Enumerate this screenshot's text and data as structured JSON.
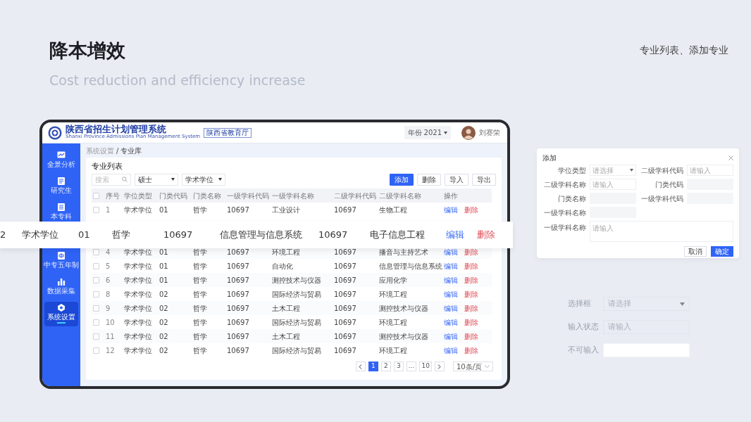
{
  "slide": {
    "title": "降本增效",
    "subtitle": "Cost reduction and efficiency increase",
    "caption": "专业列表、添加专业"
  },
  "header": {
    "system_name": "陕西省招生计划管理系统",
    "system_name_en": "Shanxi Province Admissions Plan Management System",
    "department_badge": "陕西省教育厅",
    "year_label": "年份",
    "year": "2021",
    "user_name": "刘赛荣"
  },
  "sidebar": {
    "groups": [
      [
        {
          "label": "全景分析",
          "selected": false
        },
        {
          "label": "研究生",
          "selected": false
        },
        {
          "label": "本专科",
          "selected": false
        }
      ],
      [
        {
          "label": "中专五年制",
          "selected": false
        },
        {
          "label": "数据采集",
          "selected": false
        },
        {
          "label": "系统设置",
          "selected": true
        }
      ]
    ]
  },
  "breadcrumb": {
    "items": [
      "系统设置",
      "专业库"
    ],
    "separator": "/"
  },
  "panel_title": "专业列表",
  "filters": {
    "search_placeholder": "搜索",
    "degree": "硕士",
    "degree_type": "学术学位"
  },
  "actions": [
    {
      "label": "添加",
      "primary": true
    },
    {
      "label": "删除",
      "primary": false
    },
    {
      "label": "导入",
      "primary": false
    },
    {
      "label": "导出",
      "primary": false
    }
  ],
  "table": {
    "header_checked": false,
    "columns": [
      "序号",
      "学位类型",
      "门类代码",
      "门类名称",
      "一级学科代码",
      "一级学科名称",
      "二级学科代码",
      "二级学科名称",
      "操作"
    ],
    "rows": [
      {
        "checked": false,
        "cells": [
          "1",
          "学术学位",
          "01",
          "哲学",
          "10697",
          "工业设计",
          "10697",
          "生物工程"
        ],
        "edit": "编辑",
        "delete": "删除"
      },
      {
        "checked": false,
        "cells": [
          "4",
          "学术学位",
          "01",
          "哲学",
          "10697",
          "环境工程",
          "10697",
          "播音与主持艺术"
        ],
        "edit": "编辑",
        "delete": "删除"
      },
      {
        "checked": false,
        "cells": [
          "5",
          "学术学位",
          "01",
          "哲学",
          "10697",
          "自动化",
          "10697",
          "信息管理与信息系统"
        ],
        "edit": "编辑",
        "delete": "删除"
      },
      {
        "checked": false,
        "cells": [
          "6",
          "学术学位",
          "01",
          "哲学",
          "10697",
          "测控技术与仪器",
          "10697",
          "应用化学"
        ],
        "edit": "编辑",
        "delete": "删除"
      },
      {
        "checked": false,
        "cells": [
          "8",
          "学术学位",
          "02",
          "哲学",
          "10697",
          "国际经济与贸易",
          "10697",
          "环境工程"
        ],
        "edit": "编辑",
        "delete": "删除"
      },
      {
        "checked": false,
        "cells": [
          "9",
          "学术学位",
          "02",
          "哲学",
          "10697",
          "土木工程",
          "10697",
          "测控技术与仪器"
        ],
        "edit": "编辑",
        "delete": "删除"
      },
      {
        "checked": false,
        "cells": [
          "10",
          "学术学位",
          "02",
          "哲学",
          "10697",
          "国际经济与贸易",
          "10697",
          "环境工程"
        ],
        "edit": "编辑",
        "delete": "删除"
      },
      {
        "checked": false,
        "cells": [
          "11",
          "学术学位",
          "02",
          "哲学",
          "10697",
          "土木工程",
          "10697",
          "测控技术与仪器"
        ],
        "edit": "编辑",
        "delete": "删除"
      },
      {
        "checked": false,
        "cells": [
          "12",
          "学术学位",
          "02",
          "哲学",
          "10697",
          "国际经济与贸易",
          "10697",
          "环境工程"
        ],
        "edit": "编辑",
        "delete": "删除"
      }
    ]
  },
  "pagination": {
    "pages": [
      {
        "label": "1",
        "selected": true
      },
      {
        "label": "2",
        "selected": false
      },
      {
        "label": "3",
        "selected": false
      },
      {
        "label": "...",
        "selected": false
      },
      {
        "label": "10",
        "selected": false
      }
    ],
    "page_size": "10条/页"
  },
  "highlight_row": {
    "cells": [
      "2",
      "学术学位",
      "01",
      "哲学",
      "10697",
      "信息管理与信息系统",
      "10697",
      "电子信息工程"
    ],
    "edit": "编辑",
    "delete": "删除"
  },
  "dialog": {
    "title": "添加",
    "fields": [
      {
        "label": "学位类型",
        "kind": "select",
        "placeholder": "请选择"
      },
      {
        "label": "二级学科代码",
        "kind": "input",
        "placeholder": "请输入"
      },
      {
        "label": "二级学科名称",
        "kind": "input",
        "placeholder": "请输入"
      },
      {
        "label": "门类代码",
        "kind": "disabled"
      },
      {
        "label": "门类名称",
        "kind": "disabled"
      },
      {
        "label": "一级学科代码",
        "kind": "disabled"
      },
      {
        "label": "一级学科名称",
        "kind": "disabled"
      },
      {
        "label": "一级学科名称",
        "kind": "textarea",
        "placeholder": "请输入"
      }
    ],
    "cancel": "取消",
    "confirm": "确定"
  },
  "form_states": [
    {
      "label": "选择框",
      "kind": "select",
      "placeholder": "请选择"
    },
    {
      "label": "输入状态",
      "kind": "input",
      "placeholder": "请输入"
    },
    {
      "label": "不可输入",
      "kind": "disabled"
    }
  ]
}
